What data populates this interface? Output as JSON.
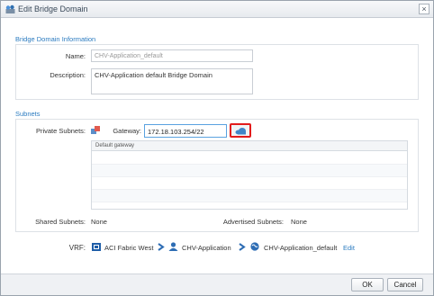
{
  "dialog": {
    "title": "Edit Bridge Domain",
    "close_glyph": "×"
  },
  "info_section": {
    "title": "Bridge Domain Information",
    "name_label": "Name:",
    "name_value": "CHV-Application_default",
    "description_label": "Description:",
    "description_value": "CHV-Application default Bridge Domain"
  },
  "subnets_section": {
    "title": "Subnets",
    "private_label": "Private Subnets:",
    "gateway_label": "Gateway:",
    "gateway_value": "172.18.103.254/22",
    "grid_header": "Default gateway",
    "shared_label": "Shared Subnets:",
    "shared_value": "None",
    "advertised_label": "Advertised Subnets:",
    "advertised_value": "None"
  },
  "vrf": {
    "label": "VRF:",
    "fabric": "ACI Fabric West",
    "tenant": "CHV-Application",
    "vrf_name": "CHV-Application_default",
    "edit_link": "Edit"
  },
  "footer": {
    "ok_label": "OK",
    "cancel_label": "Cancel"
  },
  "icons": {
    "title": "bridge-domain-icon",
    "subnet": "subnet-icon",
    "add_gateway": "add-cloud-icon",
    "fabric": "fabric-icon",
    "tenant": "tenant-icon",
    "vrf": "vrf-globe-icon",
    "arrow": "chevron-right-icon"
  },
  "colors": {
    "accent": "#2b7bc0",
    "highlight": "#e21b1b"
  }
}
